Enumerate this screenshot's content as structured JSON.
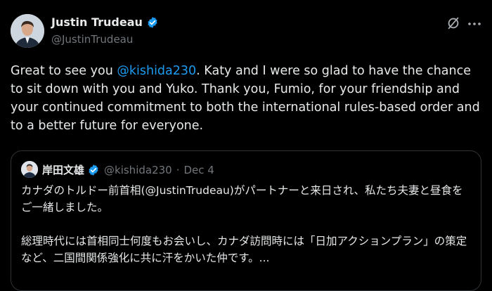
{
  "author": {
    "display_name": "Justin Trudeau",
    "handle": "@JustinTrudeau",
    "verified_icon": "verified-badge-icon"
  },
  "header_actions": {
    "grok_icon": "grok-icon",
    "more_icon": "more-options-icon"
  },
  "tweet": {
    "text_before_mention": "Great to see you ",
    "mention": "@kishida230",
    "text_after_mention": ". Katy and I were so glad to have the chance to sit down with you and Yuko. Thank you, Fumio, for your friendship and your continued commitment to both the international rules-based order and to a better future for everyone."
  },
  "quoted_tweet": {
    "display_name": "岸田文雄",
    "handle": "@kishida230",
    "separator": "·",
    "date": "Dec 4",
    "text": "カナダのトルドー前首相(@JustinTrudeau)がパートナーと来日され、私たち夫妻と昼食をご一緒しました。\n\n総理時代には首相同士何度もお会いし、カナダ訪問時には「日加アクションプラン」の策定など、二国間関係強化に共に汗をかいた仲です。..."
  },
  "colors": {
    "background": "#000000",
    "text": "#e7e9ea",
    "secondary_text": "#71767b",
    "link": "#1d9bf0",
    "verified": "#1d9bf0",
    "border": "#2f3336"
  }
}
